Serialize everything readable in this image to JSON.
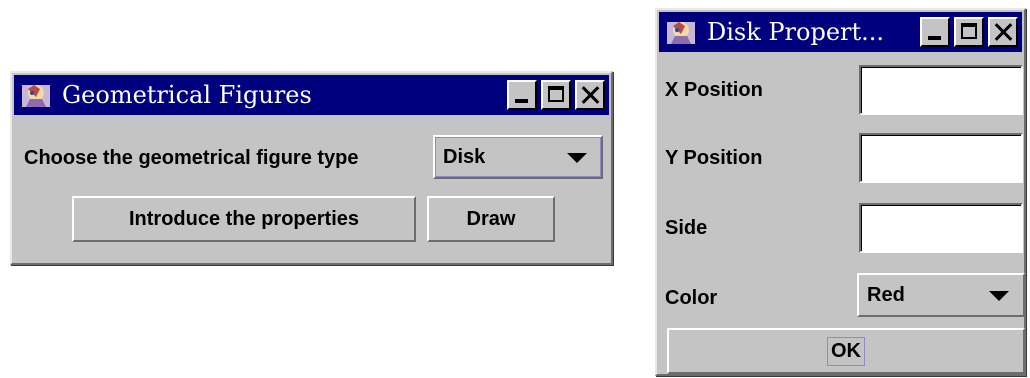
{
  "geometrical_figures": {
    "icon": "app-icon",
    "title": "Geometrical Figures",
    "choose_label": "Choose the geometrical figure type",
    "figure_type": {
      "selected": "Disk"
    },
    "introduce_button": "Introduce the properties",
    "draw_button": "Draw"
  },
  "disk_properties": {
    "icon": "app-icon",
    "title": "Disk Propert...",
    "fields": [
      {
        "label": "X Position",
        "value": ""
      },
      {
        "label": "Y Position",
        "value": ""
      },
      {
        "label": "Side",
        "value": ""
      }
    ],
    "color": {
      "label": "Color",
      "selected": "Red"
    },
    "ok_button": "OK"
  },
  "colors": {
    "titlebar": "#00007f",
    "window_bg": "#c4c4c4",
    "title_text": "#ffffff"
  },
  "window_controls": {
    "minimize_icon": "minimize-icon",
    "maximize_icon": "maximize-icon",
    "close_icon": "close-icon"
  }
}
